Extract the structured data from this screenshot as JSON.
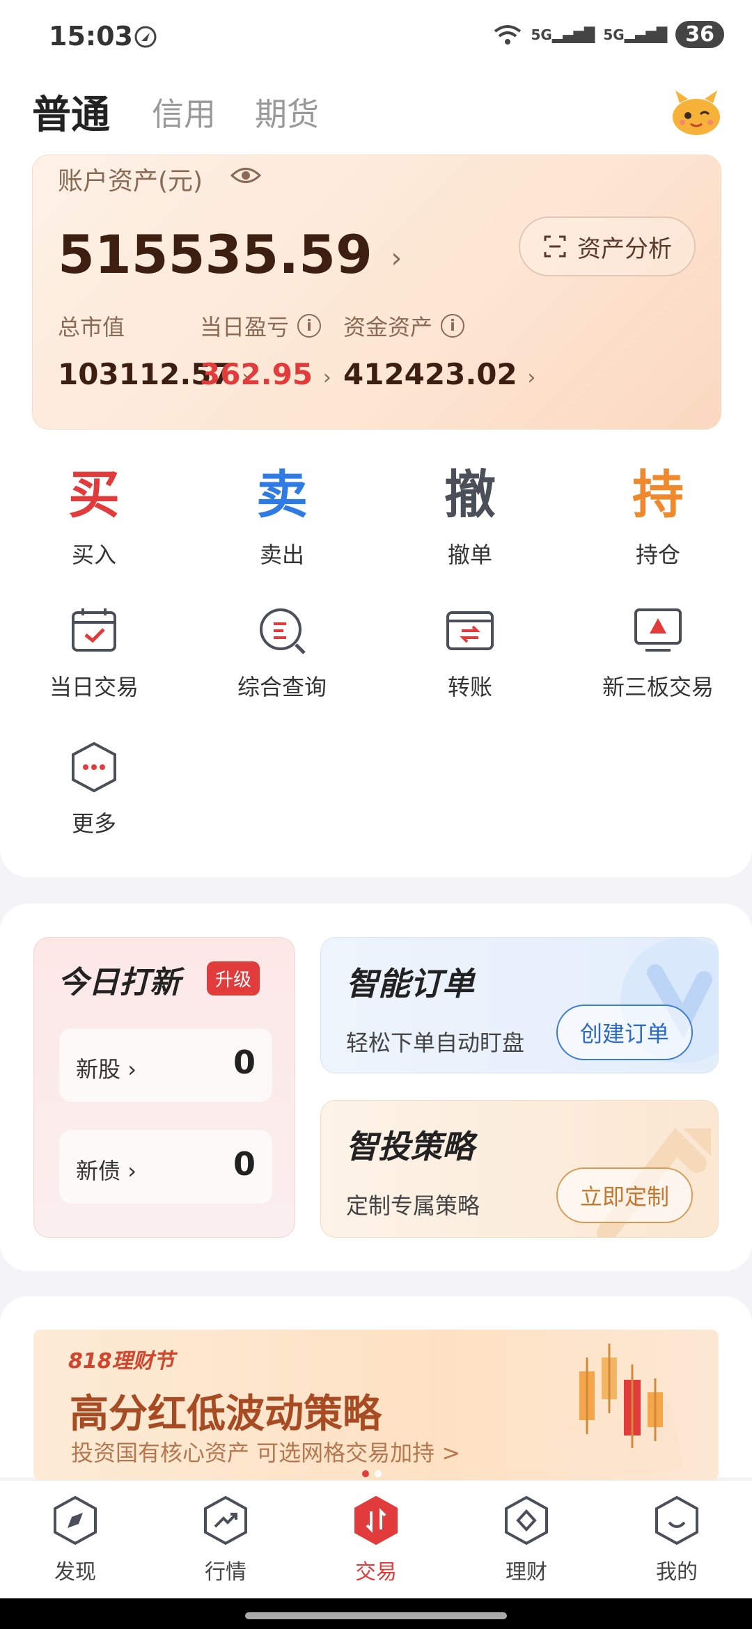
{
  "status_bar": {
    "time": "15:03",
    "network1": "5G",
    "network2": "5G",
    "battery": "36"
  },
  "top_tabs": [
    {
      "label": "普通"
    },
    {
      "label": "信用"
    },
    {
      "label": "期货"
    }
  ],
  "asset": {
    "label": "账户资产(元)",
    "total": "515535.59",
    "analysis_button": "资产分析",
    "market_value": {
      "label": "总市值",
      "value": "103112.57"
    },
    "daily_pnl": {
      "label": "当日盈亏",
      "value": "362.95"
    },
    "cash_assets": {
      "label": "资金资产",
      "value": "412423.02"
    }
  },
  "primary_actions": [
    {
      "glyph": "买",
      "label": "买入",
      "color": "#e23b3b"
    },
    {
      "glyph": "卖",
      "label": "卖出",
      "color": "#2f7be5"
    },
    {
      "glyph": "撤",
      "label": "撤单",
      "color": "#4b4f5a"
    },
    {
      "glyph": "持",
      "label": "持仓",
      "color": "#f0892b"
    }
  ],
  "secondary_actions": [
    {
      "label": "当日交易",
      "icon": "calendar-check-icon"
    },
    {
      "label": "综合查询",
      "icon": "search-icon"
    },
    {
      "label": "转账",
      "icon": "transfer-icon"
    },
    {
      "label": "新三板交易",
      "icon": "monitor-icon"
    },
    {
      "label": "更多",
      "icon": "more-icon"
    }
  ],
  "ipo": {
    "title": "今日打新",
    "badge": "升级",
    "rows": [
      {
        "name": "新股",
        "count": "0"
      },
      {
        "name": "新债",
        "count": "0"
      }
    ]
  },
  "smart_order": {
    "title": "智能订单",
    "subtitle": "轻松下单自动盯盘",
    "button": "创建订单"
  },
  "strategy": {
    "title": "智投策略",
    "subtitle": "定制专属策略",
    "button": "立即定制"
  },
  "banner": {
    "tag": "818理财节",
    "headline": "高分红低波动策略",
    "description": "投资国有核心资产 可选网格交易加持 >"
  },
  "bottom_nav": [
    {
      "label": "发现"
    },
    {
      "label": "行情"
    },
    {
      "label": "交易"
    },
    {
      "label": "理财"
    },
    {
      "label": "我的"
    }
  ],
  "colors": {
    "accent_red": "#e23b3b",
    "blue": "#2f7be5",
    "orange": "#f0892b"
  }
}
